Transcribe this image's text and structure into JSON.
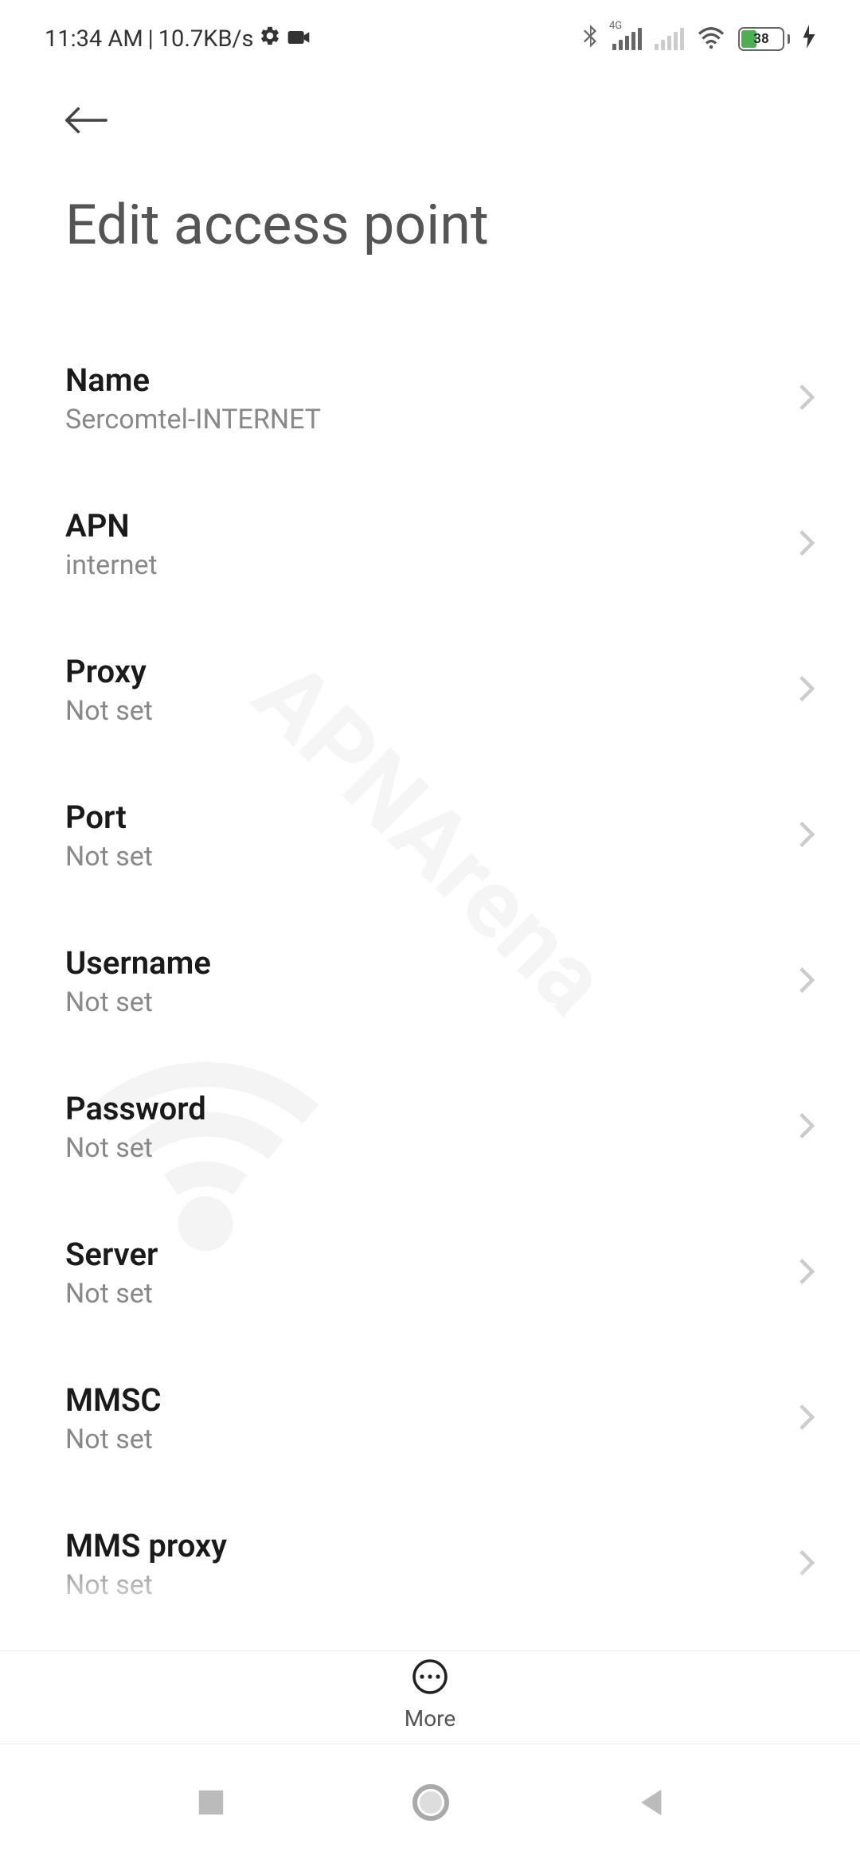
{
  "statusbar": {
    "time": "11:34 AM",
    "separator": "|",
    "speed": "10.7KB/s",
    "battery": "38"
  },
  "header": {
    "title": "Edit access point"
  },
  "settings": [
    {
      "label": "Name",
      "value": "Sercomtel-INTERNET"
    },
    {
      "label": "APN",
      "value": "internet"
    },
    {
      "label": "Proxy",
      "value": "Not set"
    },
    {
      "label": "Port",
      "value": "Not set"
    },
    {
      "label": "Username",
      "value": "Not set"
    },
    {
      "label": "Password",
      "value": "Not set"
    },
    {
      "label": "Server",
      "value": "Not set"
    },
    {
      "label": "MMSC",
      "value": "Not set"
    },
    {
      "label": "MMS proxy",
      "value": "Not set"
    }
  ],
  "toolbar": {
    "more_label": "More"
  },
  "watermark": "APNArena"
}
